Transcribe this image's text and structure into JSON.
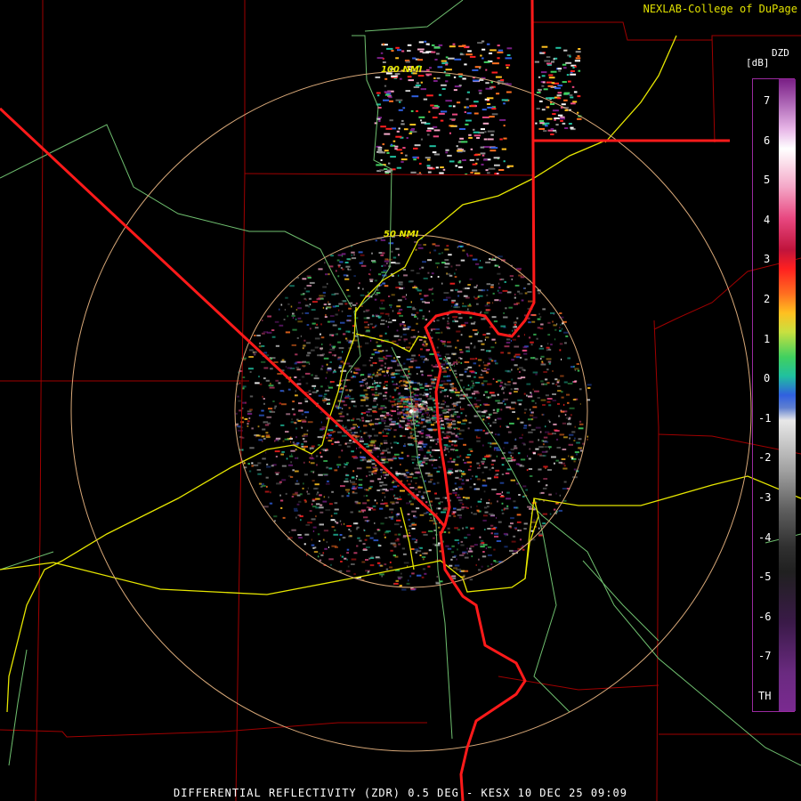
{
  "header": {
    "credit": "NEXLAB-College of DuPage"
  },
  "footer": {
    "caption": "DIFFERENTIAL REFLECTIVITY (ZDR) 0.5 DEG - KESX 10 DEC 25 09:09"
  },
  "range_rings": [
    {
      "label": "100 NMI"
    },
    {
      "label": "50 NMI"
    }
  ],
  "legend": {
    "product": "DZD",
    "unit": "[dB]",
    "ticks": [
      "7",
      "6",
      "5",
      "4",
      "3",
      "2",
      "1",
      "0",
      "-1",
      "-2",
      "-3",
      "-4",
      "-5",
      "-6",
      "-7",
      "TH"
    ]
  },
  "colors": {
    "state_border": "#ff1a1a",
    "county_border": "#b00000",
    "highway": "#e6e600",
    "road": "#7ec87e",
    "range_ring": "#d8a878"
  }
}
